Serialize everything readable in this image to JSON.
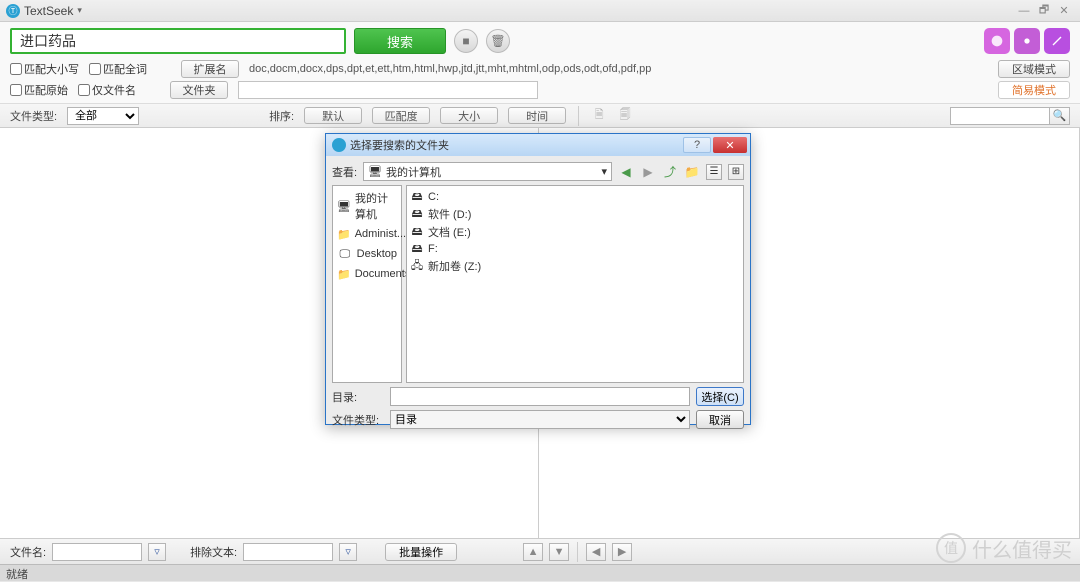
{
  "app": {
    "title": "TextSeek"
  },
  "search": {
    "value": "进口药品",
    "button": "搜索"
  },
  "options": {
    "match_case": "匹配大小写",
    "match_whole": "匹配全词",
    "match_raw": "匹配原始",
    "filename_only": "仅文件名",
    "ext_button": "扩展名",
    "ext_list": "doc,docm,docx,dps,dpt,et,ett,htm,html,hwp,jtd,jtt,mht,mhtml,odp,ods,odt,ofd,pdf,pp",
    "folder_button": "文件夹",
    "mode_region": "区域模式",
    "mode_simple": "简易模式"
  },
  "filter": {
    "file_type_label": "文件类型:",
    "file_type_value": "全部",
    "sort_label": "排序:",
    "sort_buttons": [
      "默认",
      "匹配度",
      "大小",
      "时间"
    ]
  },
  "bottom": {
    "filename_label": "文件名:",
    "exclude_label": "排除文本:",
    "batch_button": "批量操作"
  },
  "status": {
    "text": "就绪"
  },
  "watermark": {
    "text": "什么值得买",
    "badge": "值"
  },
  "dialog": {
    "title": "选择要搜索的文件夹",
    "lookin_label": "查看:",
    "lookin_value": "我的计算机",
    "places": [
      "我的计算机",
      "Administ...",
      "Desktop",
      "Documents"
    ],
    "items": [
      {
        "icon": "drive",
        "label": "C:"
      },
      {
        "icon": "drive",
        "label": "软件 (D:)"
      },
      {
        "icon": "drive",
        "label": "文档 (E:)"
      },
      {
        "icon": "drive",
        "label": "F:"
      },
      {
        "icon": "netdrive",
        "label": "新加卷 (Z:)"
      }
    ],
    "dir_label": "目录:",
    "type_label": "文件类型:",
    "type_value": "目录",
    "select_btn": "选择(C)",
    "cancel_btn": "取消"
  }
}
